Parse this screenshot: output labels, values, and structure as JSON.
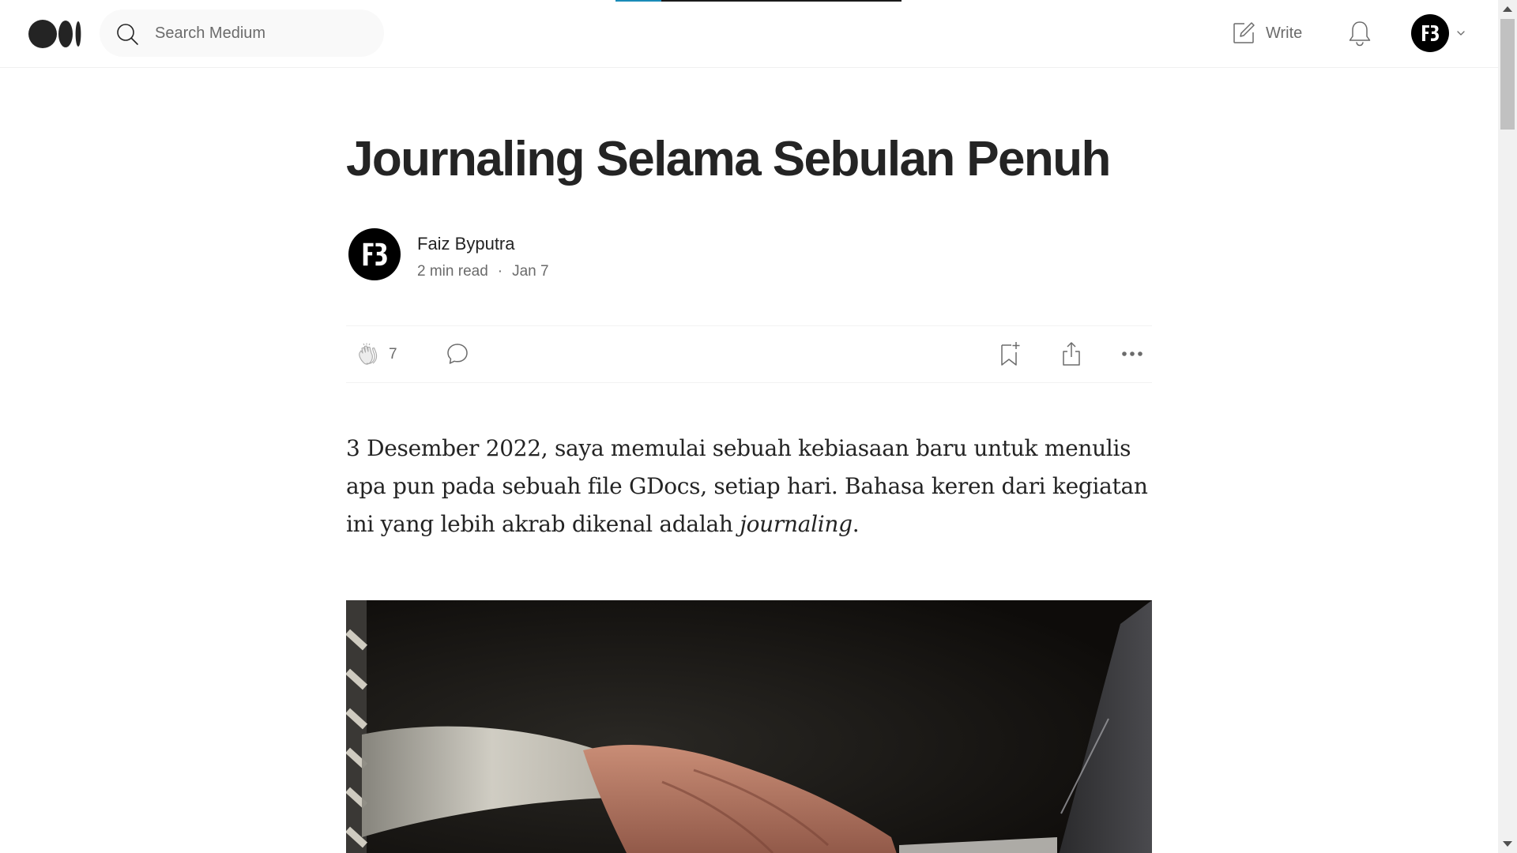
{
  "header": {
    "search_placeholder": "Search Medium",
    "write_label": "Write",
    "logo_icon": "medium-logo-icon",
    "notifications_icon": "bell-icon",
    "avatar_monogram": "FB"
  },
  "reading_progress": 0.16,
  "article": {
    "title": "Journaling Selama Sebulan Penuh",
    "author": "Faiz Byputra",
    "read_time": "2 min read",
    "separator": "·",
    "date": "Jan 7",
    "clap_count": "7",
    "body_part1": "3 Desember 2022, saya memulai sebuah kebiasaan baru untuk menulis apa pun pada sebuah file GDocs, setiap hari. Bahasa keren dari kegiatan ini yang lebih akrab dikenal adalah ",
    "body_emphasis": "journaling",
    "body_part2": "."
  },
  "colors": {
    "accent": "#1a8bb8",
    "text": "#242424",
    "muted": "#6b6b6b"
  }
}
